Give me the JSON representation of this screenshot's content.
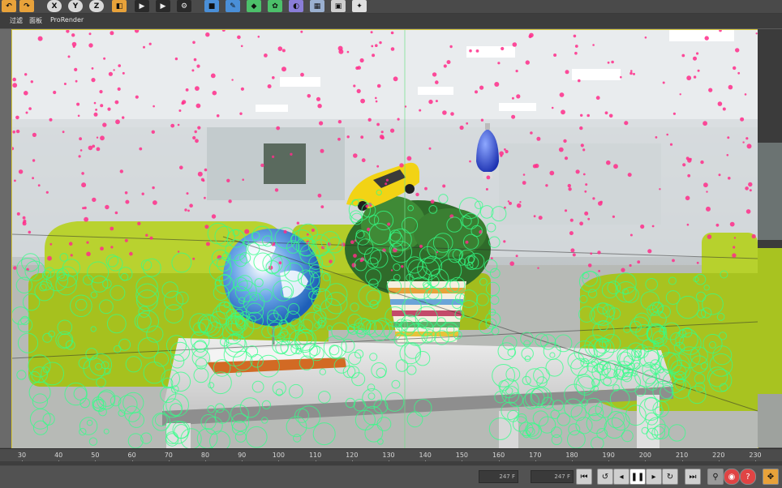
{
  "toolbar": {
    "axis_x": "X",
    "axis_y": "Y",
    "axis_z": "Z"
  },
  "menubar": {
    "items": [
      "过滤",
      "面板",
      "ProRender"
    ]
  },
  "timeline": {
    "ticks": [
      "30",
      "40",
      "50",
      "60",
      "70",
      "80",
      "90",
      "100",
      "110",
      "120",
      "130",
      "140",
      "150",
      "160",
      "170",
      "180",
      "190",
      "200",
      "210",
      "220",
      "230"
    ]
  },
  "playbar": {
    "frame_field_1": "247 F",
    "frame_field_2": "247 F"
  },
  "colors": {
    "viewport_border": "#d8c93c",
    "marker_pink": "#ff2d8a",
    "marker_green": "#33ff88"
  }
}
